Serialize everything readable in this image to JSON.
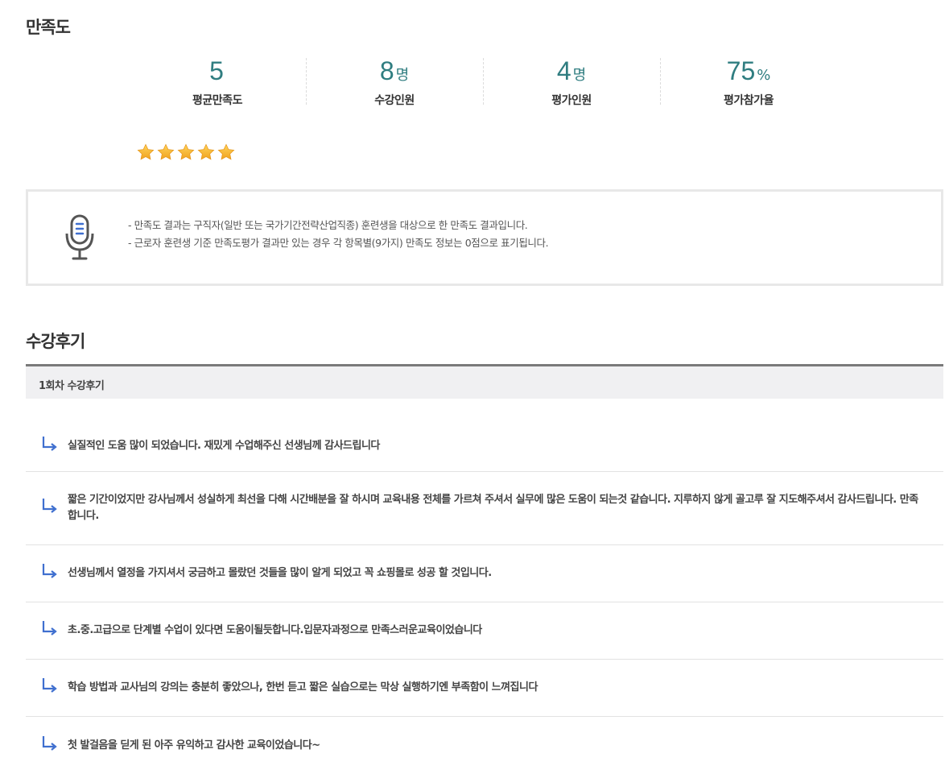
{
  "satisfaction": {
    "title": "만족도",
    "stats": [
      {
        "value": "5",
        "unit": "",
        "label": "평균만족도"
      },
      {
        "value": "8",
        "unit": "명",
        "label": "수강인원"
      },
      {
        "value": "4",
        "unit": "명",
        "label": "평가인원"
      },
      {
        "value": "75",
        "unit": "%",
        "label": "평가참가율"
      }
    ],
    "rating": {
      "stars": 5,
      "max": 5,
      "star_color": "#f2b327"
    },
    "notice_icon": "microphone-icon",
    "notice_lines": [
      "- 만족도 결과는 구직자(일반 또는 국가기간전략산업직종) 훈련생을 대상으로 한 만족도 결과입니다.",
      "- 근로자 훈련생 기준 만족도평가 결과만 있는 경우 각 항목별(9가지) 만족도 정보는 0점으로 표기됩니다."
    ]
  },
  "reviews": {
    "title": "수강후기",
    "header": "1회차 수강후기",
    "arrow_icon": "reply-arrow-icon",
    "accent_color": "#3f6fcf",
    "items": [
      {
        "text": "실질적인 도움 많이 되었습니다. 재밌게 수업해주신 선생님께 감사드립니다"
      },
      {
        "text": "짧은 기간이었지만 강사님께서 성실하게 최선을 다해 시간배분을 잘 하시며 교육내용 전체를 가르쳐 주셔서 실무에 많은 도움이 되는것 같습니다. 지루하지 않게 골고루 잘 지도해주셔서 감사드립니다. 만족합니다."
      },
      {
        "text": "선생님께서 열정을 가지셔서 궁금하고 몰랐던 것들을 많이 알게 되었고 꼭 쇼핑몰로 성공 할 것입니다."
      },
      {
        "text": "초.중.고급으로 단계별 수업이 있다면 도움이될듯합니다.입문자과정으로 만족스러운교육이었습니다"
      },
      {
        "text": "학습 방법과 교사님의 강의는 충분히 좋았으나, 한번 듣고 짧은 실습으로는 막상 실행하기엔 부족함이 느껴집니다"
      },
      {
        "text": "첫 발걸음을 딛게 된 아주 유익하고 감사한 교육이었습니다~"
      }
    ]
  }
}
